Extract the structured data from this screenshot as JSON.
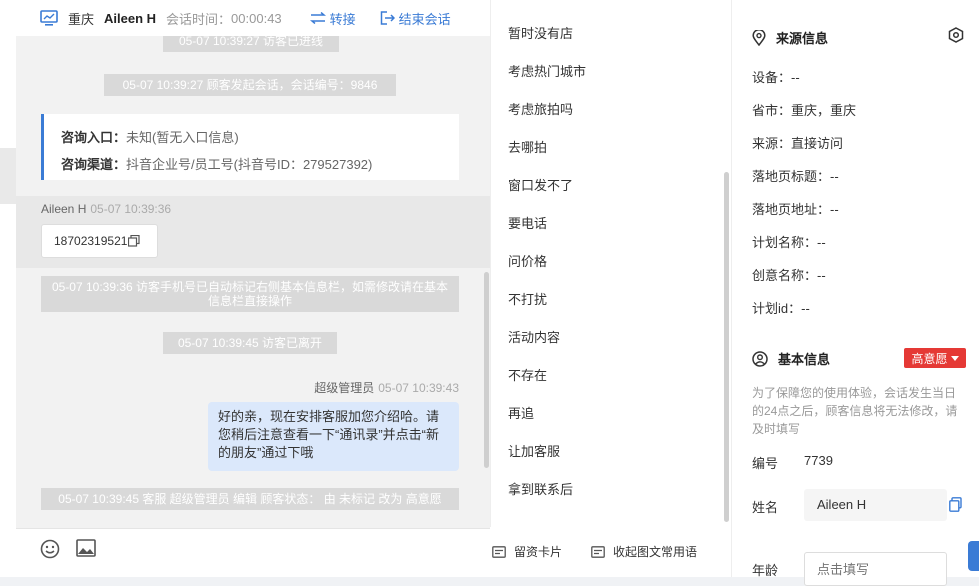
{
  "header": {
    "city": "重庆",
    "visitor_name": "Aileen H",
    "session_time_label": "会话时间：",
    "session_time": "00:00:43",
    "transfer_label": "转接",
    "end_session_label": "结束会话"
  },
  "messages": {
    "sys_top_partial": "05-07 10:39:27 访客已进线",
    "sys_session_start": "05-07 10:39:27 顾客发起会话，会话编号：9846",
    "card": {
      "entry_label": "咨询入口：",
      "entry_value": "未知(暂无入口信息)",
      "channel_label": "咨询渠道：",
      "channel_value": "抖音企业号/员工号(抖音号ID：279527392)"
    },
    "user_name": "Aileen H",
    "user_time": "05-07 10:39:36",
    "user_phone": "18702319521",
    "sys_phone_marked": "05-07 10:39:36 访客手机号已自动标记右侧基本信息栏，如需修改请在基本信息栏直接操作",
    "sys_left": "05-07 10:39:45 访客已离开",
    "agent_name": "超级管理员",
    "agent_time": "05-07 10:39:43",
    "agent_text": "好的亲，现在安排客服加您介绍哈。请您稍后注意查看一下“通讯录”并点击“新的朋友”通过下哦",
    "sys_status_change": "05-07 10:39:45 客服 超级管理员 编辑 顾客状态： 由 未标记 改为 高意愿"
  },
  "footer": {
    "emoji_icon": "smile-icon",
    "image_icon": "image-icon"
  },
  "phrases": {
    "items": [
      "暂时没有店",
      "考虑热门城市",
      "考虑旅拍吗",
      "去哪拍",
      "窗口发不了",
      "要电话",
      "问价格",
      "不打扰",
      "活动内容",
      "不存在",
      "再追",
      "让加客服",
      "拿到联系后"
    ],
    "card_link": "留资卡片",
    "collapse_link": "收起图文常用语"
  },
  "info": {
    "source_title": "来源信息",
    "source_rows": [
      "设备：--",
      "省市：重庆，重庆",
      "来源：直接访问",
      "落地页标题：--",
      "落地页地址：--",
      "计划名称：--",
      "创意名称：--",
      "计划id：--"
    ],
    "basic_title": "基本信息",
    "intent_badge": "高意愿",
    "note": "为了保障您的使用体验，会话发生当日的24点之后，顾客信息将无法修改，请及时填写",
    "id_label": "编号",
    "id_value": "7739",
    "name_label": "姓名",
    "name_value": "Aileen H",
    "age_label": "年龄",
    "age_placeholder": "点击填写"
  },
  "colors": {
    "accent": "#3a7bd5",
    "badge_red": "#e53935",
    "agent_bubble": "#dbe8fb",
    "system_gray": "#d9d9d9"
  }
}
